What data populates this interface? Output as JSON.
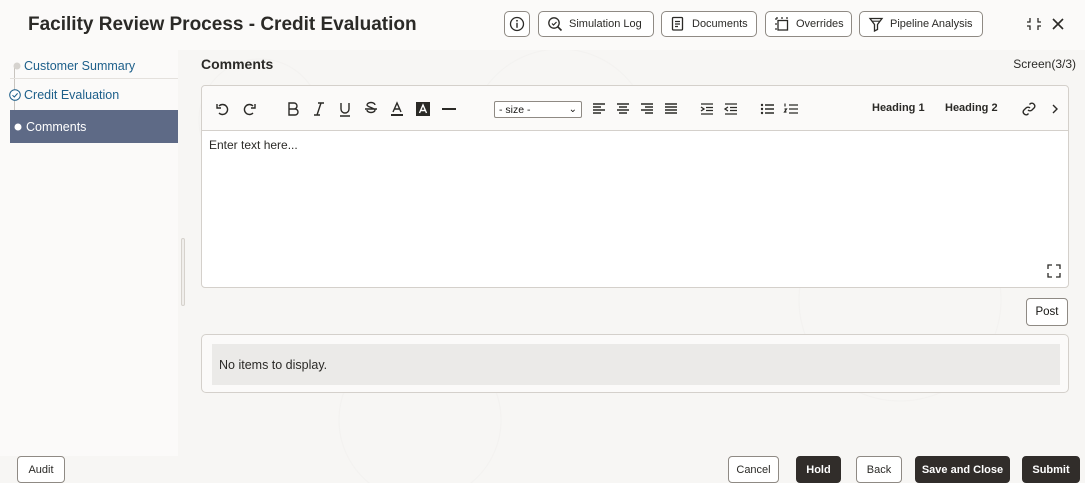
{
  "header": {
    "title": "Facility Review Process - Credit Evaluation",
    "buttons": {
      "info_icon": "info-icon",
      "simulation_log": "Simulation Log",
      "documents": "Documents",
      "overrides": "Overrides",
      "pipeline_analysis": "Pipeline Analysis"
    }
  },
  "sidebar": {
    "items": [
      {
        "label": "Customer Summary",
        "state": "visited"
      },
      {
        "label": "Credit Evaluation",
        "state": "done"
      },
      {
        "label": "Comments",
        "state": "active"
      }
    ]
  },
  "main": {
    "title": "Comments",
    "screen": "Screen(3/3)",
    "editor": {
      "size_select": "- size -",
      "heading1": "Heading 1",
      "heading2": "Heading 2",
      "placeholder": "Enter text here..."
    },
    "post_label": "Post",
    "empty_message": "No items to display."
  },
  "footer": {
    "audit": "Audit",
    "cancel": "Cancel",
    "hold": "Hold",
    "back": "Back",
    "save_and_close": "Save and Close",
    "submit": "Submit"
  },
  "colors": {
    "active_nav_bg": "#5e6a86",
    "nav_link": "#1d5f8a",
    "primary_button": "#312d2a"
  }
}
